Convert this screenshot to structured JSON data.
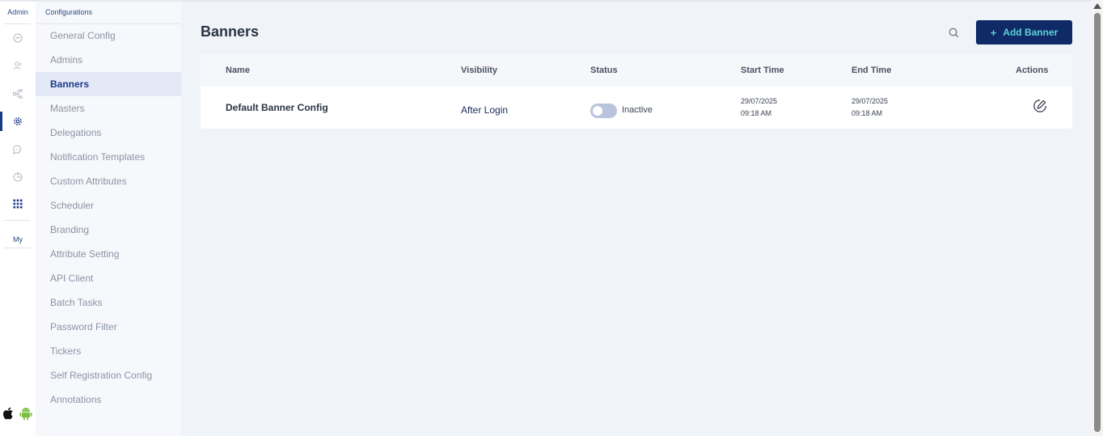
{
  "rail": {
    "top_label": "Admin",
    "bottom_label": "My",
    "icons": [
      "dashboard-icon",
      "users-icon",
      "hierarchy-icon",
      "settings-icon",
      "chat-icon",
      "report-icon",
      "apps-grid-icon"
    ],
    "os_icons": [
      "apple-icon",
      "android-icon"
    ]
  },
  "sidebar": {
    "title": "Configurations",
    "items": [
      {
        "label": "General Config"
      },
      {
        "label": "Admins"
      },
      {
        "label": "Banners",
        "active": true
      },
      {
        "label": "Masters"
      },
      {
        "label": "Delegations"
      },
      {
        "label": "Notification Templates"
      },
      {
        "label": "Custom Attributes"
      },
      {
        "label": "Scheduler"
      },
      {
        "label": "Branding"
      },
      {
        "label": "Attribute Setting"
      },
      {
        "label": "API Client"
      },
      {
        "label": "Batch Tasks"
      },
      {
        "label": "Password Filter"
      },
      {
        "label": "Tickers"
      },
      {
        "label": "Self Registration Config"
      },
      {
        "label": "Annotations"
      }
    ]
  },
  "main": {
    "title": "Banners",
    "add_button": {
      "plus": "+",
      "label": "Add Banner"
    },
    "table": {
      "headers": {
        "name": "Name",
        "visibility": "Visibility",
        "status": "Status",
        "start": "Start Time",
        "end": "End Time",
        "actions": "Actions"
      },
      "rows": [
        {
          "name": "Default Banner Config",
          "visibility": "After Login",
          "status": "Inactive",
          "status_on": false,
          "start_date": "29/07/2025",
          "start_time": "09:18 AM",
          "end_date": "29/07/2025",
          "end_time": "09:18 AM"
        }
      ]
    }
  },
  "colors": {
    "brand_navy": "#0f2a66",
    "accent_teal": "#5ed1d6",
    "active_bg": "#e3e9f7"
  }
}
